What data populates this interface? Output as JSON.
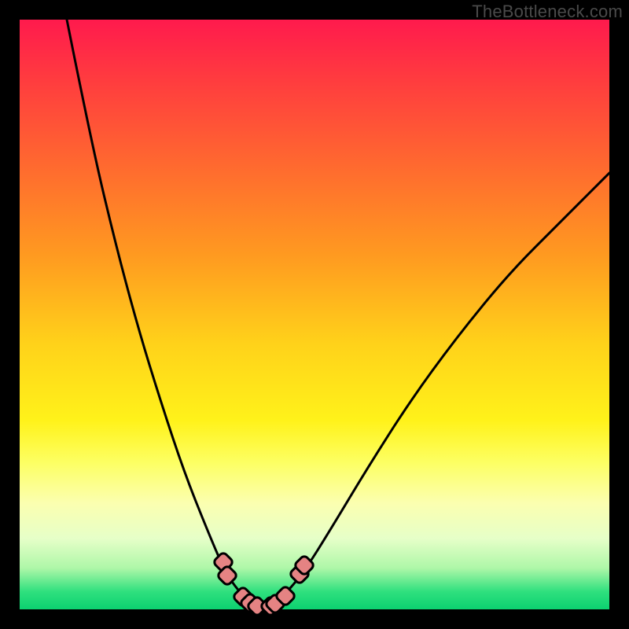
{
  "watermark": "TheBottleneck.com",
  "chart_data": {
    "type": "line",
    "title": "",
    "xlabel": "",
    "ylabel": "",
    "xlim": [
      0,
      100
    ],
    "ylim": [
      0,
      100
    ],
    "grid": false,
    "legend": false,
    "curve": [
      {
        "x": 8,
        "y": 100
      },
      {
        "x": 12,
        "y": 80
      },
      {
        "x": 16,
        "y": 63
      },
      {
        "x": 20,
        "y": 48
      },
      {
        "x": 24,
        "y": 35
      },
      {
        "x": 28,
        "y": 23
      },
      {
        "x": 32,
        "y": 13
      },
      {
        "x": 35,
        "y": 6
      },
      {
        "x": 38,
        "y": 2
      },
      {
        "x": 41,
        "y": 0.3
      },
      {
        "x": 44,
        "y": 1.5
      },
      {
        "x": 48,
        "y": 6
      },
      {
        "x": 53,
        "y": 14
      },
      {
        "x": 59,
        "y": 24
      },
      {
        "x": 66,
        "y": 35
      },
      {
        "x": 74,
        "y": 46
      },
      {
        "x": 83,
        "y": 57
      },
      {
        "x": 92,
        "y": 66
      },
      {
        "x": 100,
        "y": 74
      }
    ],
    "markers": [
      {
        "x": 34.5,
        "y": 8
      },
      {
        "x": 35.2,
        "y": 5.8
      },
      {
        "x": 37.8,
        "y": 2.2
      },
      {
        "x": 39.0,
        "y": 1.1
      },
      {
        "x": 40.2,
        "y": 0.5
      },
      {
        "x": 42.5,
        "y": 0.5
      },
      {
        "x": 43.3,
        "y": 1.0
      },
      {
        "x": 45.0,
        "y": 2.3
      },
      {
        "x": 47.5,
        "y": 6.0
      },
      {
        "x": 48.3,
        "y": 7.5
      }
    ],
    "background_gradient": {
      "top": "#ff1a4d",
      "mid": "#fff21a",
      "bottom": "#0cd170"
    }
  }
}
